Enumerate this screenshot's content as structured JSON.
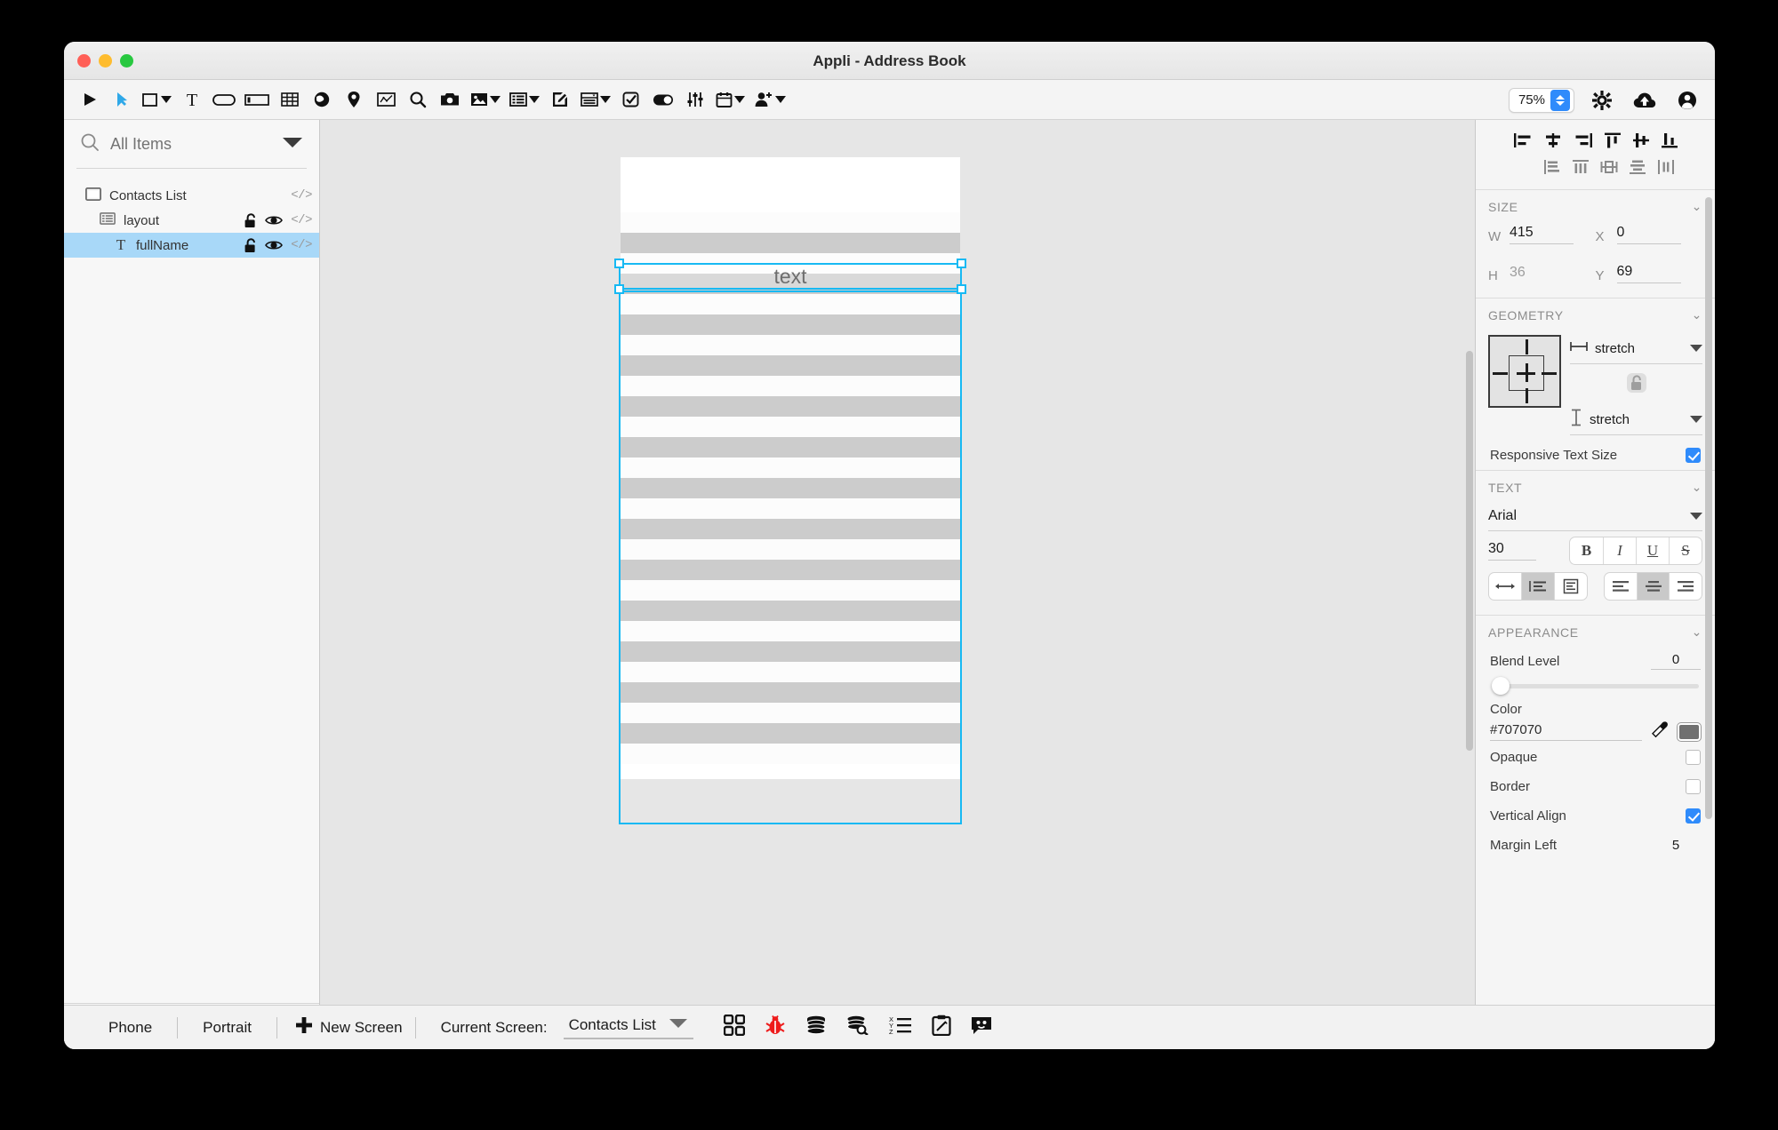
{
  "window": {
    "title": "Appli - Address Book",
    "traffic_lights": [
      "close",
      "minimize",
      "zoom"
    ]
  },
  "toolbar": {
    "items": [
      {
        "name": "run-button",
        "icon": "play-triangle"
      },
      {
        "name": "select-tool",
        "icon": "cursor-arrow"
      },
      {
        "name": "rectangle-tool",
        "icon": "rectangle",
        "has_dropdown": true
      },
      {
        "name": "text-tool",
        "icon": "text-serif-t"
      },
      {
        "name": "button-tool",
        "icon": "rounded-rect"
      },
      {
        "name": "input-field-tool",
        "icon": "input-field"
      },
      {
        "name": "table-tool",
        "icon": "grid-table"
      },
      {
        "name": "web-tool",
        "icon": "globe"
      },
      {
        "name": "map-tool",
        "icon": "map-pin"
      },
      {
        "name": "chart-tool",
        "icon": "chart-line"
      },
      {
        "name": "search-tool",
        "icon": "magnifier"
      },
      {
        "name": "camera-tool",
        "icon": "camera"
      },
      {
        "name": "image-tool",
        "icon": "picture",
        "has_dropdown": true
      },
      {
        "name": "list-tool",
        "icon": "list-view",
        "has_dropdown": true
      },
      {
        "name": "note-tool",
        "icon": "pencil-square"
      },
      {
        "name": "form-tool",
        "icon": "form-panel",
        "has_dropdown": true
      },
      {
        "name": "checkbox-tool",
        "icon": "checkbox"
      },
      {
        "name": "switch-tool",
        "icon": "toggle-switch"
      },
      {
        "name": "sliders-tool",
        "icon": "equalizer-sliders"
      },
      {
        "name": "calendar-tool",
        "icon": "calendar",
        "has_dropdown": true
      },
      {
        "name": "contact-tool",
        "icon": "person-plus",
        "has_dropdown": true
      }
    ],
    "zoom_value": "75%",
    "right_items": [
      {
        "name": "settings-button",
        "icon": "gear-icon"
      },
      {
        "name": "upload-cloud-button",
        "icon": "cloud-upload-icon"
      },
      {
        "name": "account-button",
        "icon": "user-circle-icon"
      }
    ]
  },
  "sidebar": {
    "search_placeholder": "All Items",
    "search_value": "All Items",
    "tree": [
      {
        "label": "Contacts List",
        "icon": "screen-icon",
        "level": 1,
        "selected": false,
        "has_lock": false,
        "has_eye": false,
        "code_tag": "</>"
      },
      {
        "label": "layout",
        "icon": "layout-icon",
        "level": 2,
        "selected": false,
        "has_lock": true,
        "has_eye": true,
        "code_tag": "</>"
      },
      {
        "label": "fullName",
        "icon": "text-icon",
        "level": 3,
        "selected": true,
        "has_lock": true,
        "has_eye": true,
        "code_tag": "</>"
      }
    ],
    "bottom_icons": [
      {
        "name": "list-view-button",
        "icon": "list-blue-icon"
      },
      {
        "name": "bookmark-button",
        "icon": "bookmark-icon"
      }
    ]
  },
  "canvas": {
    "selected_element_text": "text",
    "selection_color": "#17b9f3",
    "stripe_gray": "#cccccc",
    "stripe_white": "#fcfcfc",
    "stripe_count": 26
  },
  "inspector": {
    "align_row_1": [
      {
        "name": "align-left-icon"
      },
      {
        "name": "align-center-horizontal-icon"
      },
      {
        "name": "align-right-icon"
      },
      {
        "name": "align-top-icon"
      },
      {
        "name": "align-middle-vertical-icon"
      },
      {
        "name": "align-bottom-icon"
      }
    ],
    "align_row_2": [
      {
        "name": "distribute-left-icon"
      },
      {
        "name": "distribute-horizontal-icon"
      },
      {
        "name": "distribute-center-icon"
      },
      {
        "name": "distribute-vertical-icon"
      },
      {
        "name": "distribute-spacing-icon"
      }
    ],
    "size": {
      "title": "SIZE",
      "w_label": "W",
      "w_value": "415",
      "x_label": "X",
      "x_value": "0",
      "h_label": "H",
      "h_value": "36",
      "y_label": "Y",
      "y_value": "69"
    },
    "geometry": {
      "title": "GEOMETRY",
      "horizontal_mode": "stretch",
      "vertical_mode": "stretch",
      "lock_state": "unlocked",
      "responsive_text_size_label": "Responsive Text Size",
      "responsive_text_size_checked": true
    },
    "text": {
      "title": "TEXT",
      "font_family": "Arial",
      "font_size": "30",
      "style_buttons": [
        {
          "label": "B",
          "name": "bold-button",
          "active": false
        },
        {
          "label": "I",
          "name": "italic-button",
          "active": false
        },
        {
          "label": "U",
          "name": "underline-button",
          "active": false
        },
        {
          "label": "S",
          "name": "strikethrough-button",
          "active": false
        }
      ],
      "wrap_buttons": [
        {
          "name": "no-wrap-button",
          "icon": "arrows-horizontal",
          "active": false
        },
        {
          "name": "wrap-lines-button",
          "icon": "line-wrap",
          "active": true
        },
        {
          "name": "fit-box-button",
          "icon": "text-box",
          "active": false
        }
      ],
      "align_buttons": [
        {
          "name": "text-align-left-button",
          "icon": "align-left-lines",
          "active": false
        },
        {
          "name": "text-align-center-button",
          "icon": "align-center-lines",
          "active": true
        },
        {
          "name": "text-align-right-button",
          "icon": "align-right-lines",
          "active": false
        }
      ]
    },
    "appearance": {
      "title": "APPEARANCE",
      "blend_level_label": "Blend Level",
      "blend_level_value": "0",
      "blend_slider_percent": 0,
      "color_label": "Color",
      "color_value": "#707070",
      "color_swatch": "#707070",
      "eyedropper_icon": "eyedropper-icon",
      "opaque_label": "Opaque",
      "opaque_checked": false,
      "border_label": "Border",
      "border_checked": false,
      "vertical_align_label": "Vertical Align",
      "vertical_align_checked": true,
      "margin_left_label": "Margin Left",
      "margin_left_value": "5"
    },
    "bottom_icons": [
      {
        "name": "no-action-icon"
      },
      {
        "name": "code-icon",
        "label": "</>"
      }
    ]
  },
  "statusbar": {
    "device": "Phone",
    "orientation": "Portrait",
    "new_screen_label": "New Screen",
    "current_screen_label": "Current Screen:",
    "current_screen_value": "Contacts List",
    "icons": [
      {
        "name": "screens-grid-button",
        "icon": "four-squares"
      },
      {
        "name": "debug-button",
        "icon": "ladybug",
        "color": "#ee1b1b"
      },
      {
        "name": "database-button",
        "icon": "database-stack"
      },
      {
        "name": "query-database-button",
        "icon": "database-search"
      },
      {
        "name": "variables-button",
        "icon": "xyz-list"
      },
      {
        "name": "notes-button",
        "icon": "clipboard-pencil"
      },
      {
        "name": "chat-button",
        "icon": "speech-bubble"
      }
    ]
  }
}
